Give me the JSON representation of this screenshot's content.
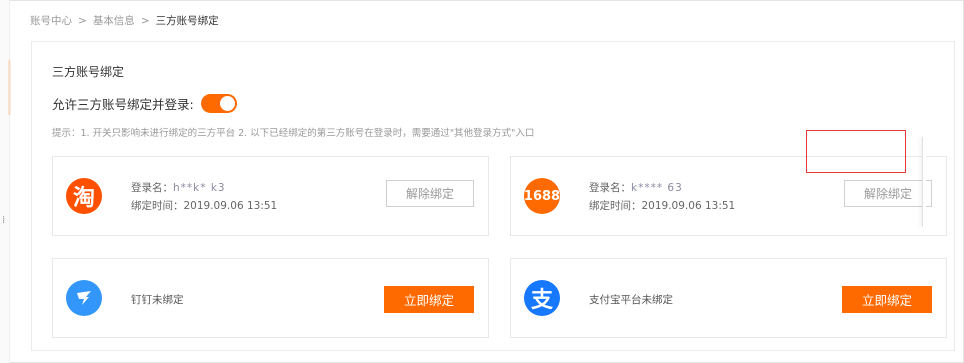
{
  "breadcrumb": {
    "items": [
      "账号中心",
      "基本信息",
      "三方账号绑定"
    ],
    "separator": ">"
  },
  "section": {
    "title": "三方账号绑定",
    "allow_label": "允许三方账号绑定并登录:",
    "allow_enabled": true,
    "tip": "提示：1. 开关只影响未进行绑定的三方平台 2. 以下已经绑定的第三方账号在登录时，需要通过\"其他登录方式\"入口"
  },
  "accounts": {
    "taobao": {
      "logo_text": "淘",
      "login_prefix": "登录名：",
      "login_masked": "h**k* k3",
      "time_prefix": "绑定时间：",
      "time": "2019.09.06 13:51",
      "action": "解除绑定"
    },
    "a1688": {
      "logo_text": "1688",
      "login_prefix": "登录名：",
      "login_masked": "k**** 63",
      "time_prefix": "绑定时间：",
      "time": "2019.09.06 13:51",
      "action": "解除绑定"
    },
    "dingtalk": {
      "status": "钉钉未绑定",
      "action": "立即绑定"
    },
    "alipay": {
      "logo_text": "支",
      "status": "支付宝平台未绑定",
      "action": "立即绑定"
    }
  },
  "colors": {
    "accent": "#ff6a00",
    "taobao": "#ff5000",
    "dingtalk": "#3296fa",
    "alipay": "#1677ff",
    "highlight": "#e53935"
  }
}
